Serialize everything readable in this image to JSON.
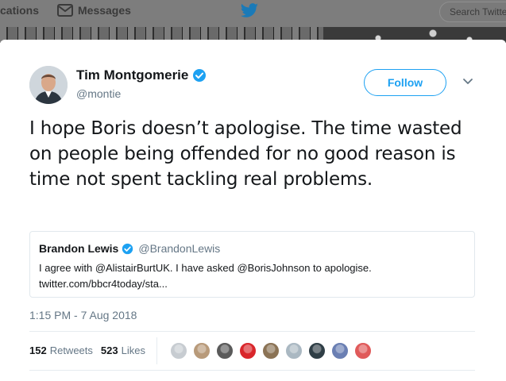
{
  "nav": {
    "notifications_label": "cations",
    "messages_label": "Messages",
    "search_placeholder": "Search Twitter"
  },
  "tweet": {
    "author": {
      "display_name": "Tim Montgomerie",
      "handle": "@montie",
      "verified": true
    },
    "follow_label": "Follow",
    "text": "I hope Boris doesn’t apologise. The time wasted on people being offended for no good reason is time not spent tackling real problems.",
    "quoted": {
      "display_name": "Brandon Lewis",
      "handle": "@BrandonLewis",
      "verified": true,
      "text_line1": "I agree with @AlistairBurtUK. I have asked @BorisJohnson to apologise.",
      "text_line2": "twitter.com/bbcr4today/sta..."
    },
    "timestamp": "1:15 PM - 7 Aug 2018",
    "retweets_count": "152",
    "retweets_label": "Retweets",
    "likes_count": "523",
    "likes_label": "Likes",
    "liker_avatar_colors": [
      "#c7ccd1",
      "#b89a7a",
      "#5a5a5a",
      "#d9262b",
      "#8b7355",
      "#aab8c2",
      "#2f3e46",
      "#6a7fb3",
      "#e05a5a"
    ]
  },
  "colors": {
    "accent": "#1da1f2",
    "text": "#14171a",
    "secondary": "#657786"
  }
}
